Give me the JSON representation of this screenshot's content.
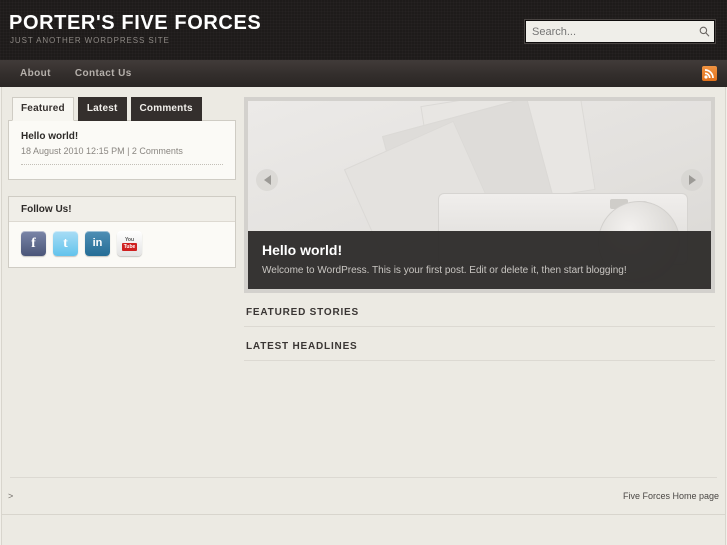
{
  "header": {
    "site_title": "PORTER'S FIVE FORCES",
    "tagline": "JUST ANOTHER WORDPRESS SITE",
    "search": {
      "placeholder": "Search...",
      "value": "",
      "icon": "search-icon"
    }
  },
  "nav": {
    "items": [
      {
        "label": "About"
      },
      {
        "label": "Contact Us"
      }
    ],
    "rss": {
      "icon": "rss-icon",
      "label": "RSS"
    }
  },
  "sidebar": {
    "tabs": [
      {
        "label": "Featured",
        "active": true
      },
      {
        "label": "Latest",
        "active": false
      },
      {
        "label": "Comments",
        "active": false
      }
    ],
    "posts": [
      {
        "title": "Hello world!",
        "meta": "18 August 2010 12:15 PM | 2 Comments"
      }
    ],
    "follow_widget": {
      "title": "Follow Us!",
      "socials": [
        {
          "name": "facebook-icon",
          "glyph": "f"
        },
        {
          "name": "twitter-icon",
          "glyph": "t"
        },
        {
          "name": "linkedin-icon",
          "glyph": "in"
        },
        {
          "name": "youtube-icon",
          "glyph_top": "You",
          "glyph_bottom": "Tube"
        }
      ]
    }
  },
  "main": {
    "slider": {
      "prev_label": "Previous slide",
      "next_label": "Next slide",
      "caption_title": "Hello world!",
      "caption_text": "Welcome to WordPress. This is your first post. Edit or delete it, then start blogging!"
    },
    "sections": [
      {
        "heading": "FEATURED STORIES"
      },
      {
        "heading": "LATEST HEADLINES"
      }
    ]
  },
  "footer": {
    "left_text": ">",
    "right_text": "Five Forces Home page"
  },
  "colors": {
    "header_bg": "#1e1b1a",
    "nav_bg": "#3a3533",
    "page_bg": "#f1efe9",
    "content_bg": "#eceae3",
    "panel_bg": "#fbfaf6",
    "rss_orange": "#e2711b",
    "tab_active_bg": "#f7f6f1",
    "tab_inactive_bg": "#342f2d",
    "caption_bg": "#292726"
  }
}
